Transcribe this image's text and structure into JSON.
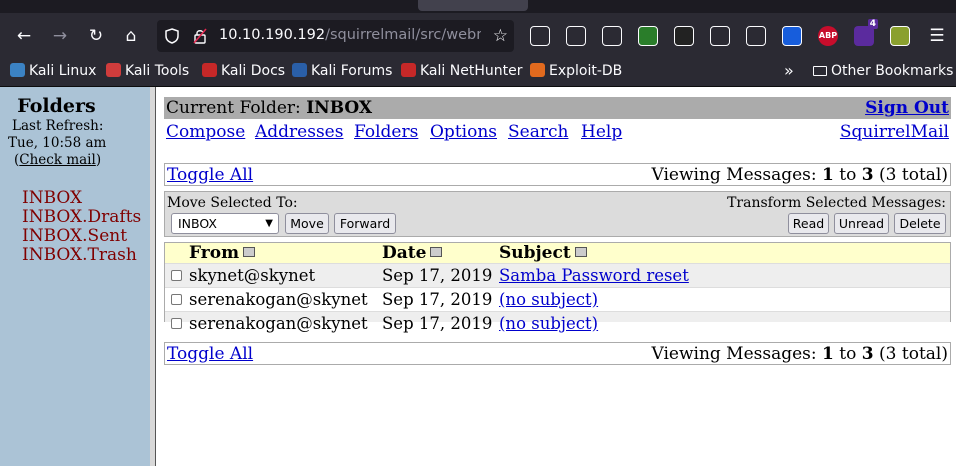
{
  "browser": {
    "url_host": "10.10.190.192",
    "url_path": "/squirrelmail/src/webmail.php",
    "extensions": [
      {
        "icon": "pocket-icon",
        "color": "#2b2a33"
      },
      {
        "icon": "vivaldi-icon",
        "color": "#2b2a33"
      },
      {
        "icon": "extensions-puzzle-icon",
        "color": "#2b2a33"
      },
      {
        "icon": "json-braces-icon",
        "color": "#2a7d2a"
      },
      {
        "icon": "ninja-icon",
        "color": "#222222"
      },
      {
        "icon": "cookies-icon",
        "color": "#2b2a33"
      },
      {
        "icon": "burp-icon",
        "color": "#2b2a33"
      },
      {
        "icon": "bitwarden-icon",
        "color": "#175ddc"
      },
      {
        "label": "ABP",
        "icon": "adblock-icon",
        "color": "#c70d2c"
      },
      {
        "badge": "4",
        "icon": "ublock-icon",
        "color": "#5b2b9e"
      },
      {
        "icon": "image-icon",
        "color": "#8aa02e"
      }
    ]
  },
  "bookmarks": [
    {
      "label": "Kali Linux",
      "icon": "kali-icon",
      "color": "#3b82c4"
    },
    {
      "label": "Kali Tools",
      "icon": "kali-tools-icon",
      "color": "#d03c3c"
    },
    {
      "label": "Kali Docs",
      "icon": "kali-docs-icon",
      "color": "#c62828"
    },
    {
      "label": "Kali Forums",
      "icon": "kali-forums-icon",
      "color": "#2a5fa8"
    },
    {
      "label": "Kali NetHunter",
      "icon": "nethunter-icon",
      "color": "#c62828"
    },
    {
      "label": "Exploit-DB",
      "icon": "exploitdb-icon",
      "color": "#e26a1e"
    }
  ],
  "bookmarks_overflow": "»",
  "other_bookmarks": "Other Bookmarks",
  "sidebar": {
    "title": "Folders",
    "refresh_label": "Last Refresh:",
    "refresh_time": "Tue, 10:58 am",
    "check_mail": "Check mail",
    "folders": [
      "INBOX",
      "INBOX.Drafts",
      "INBOX.Sent",
      "INBOX.Trash"
    ]
  },
  "header": {
    "current_folder_label": "Current Folder:",
    "current_folder": "INBOX",
    "sign_out": "Sign Out"
  },
  "menu": [
    "Compose",
    "Addresses",
    "Folders",
    "Options",
    "Search",
    "Help"
  ],
  "brand": "SquirrelMail",
  "viewing": {
    "toggle_all": "Toggle All",
    "prefix": "Viewing Messages:",
    "start": "1",
    "to": "to",
    "end": "3",
    "total": "(3 total)"
  },
  "actions": {
    "move_label": "Move Selected To:",
    "move_target": "INBOX",
    "move_button": "Move",
    "forward_button": "Forward",
    "transform_label": "Transform Selected Messages:",
    "read_button": "Read",
    "unread_button": "Unread",
    "delete_button": "Delete"
  },
  "table": {
    "columns": [
      "From",
      "Date",
      "Subject"
    ],
    "rows": [
      {
        "from": "skynet@skynet",
        "date": "Sep 17, 2019",
        "subject": "Samba Password reset"
      },
      {
        "from": "serenakogan@skynet",
        "date": "Sep 17, 2019",
        "subject": "(no subject)"
      },
      {
        "from": "serenakogan@skynet",
        "date": "Sep 17, 2019",
        "subject": "(no subject)"
      }
    ]
  }
}
